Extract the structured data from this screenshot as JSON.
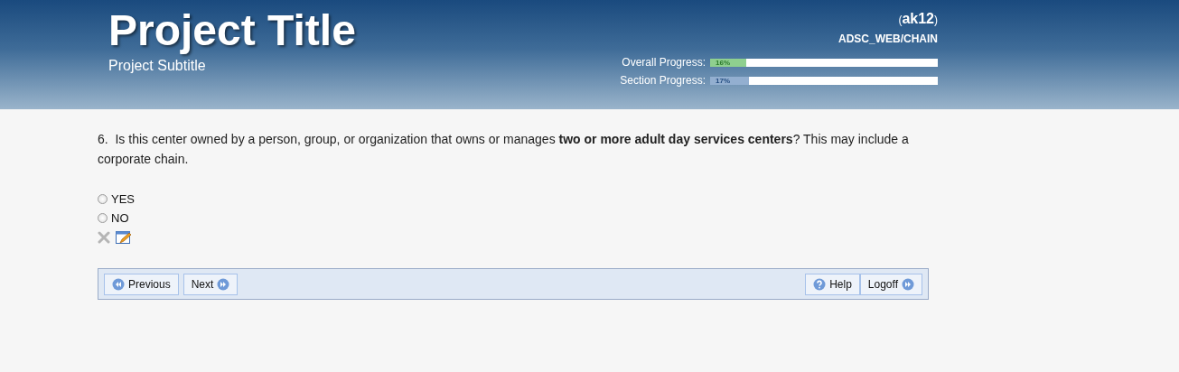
{
  "header": {
    "title": "Project Title",
    "subtitle": "Project Subtitle",
    "user": "(**ak12**)",
    "path": "ADSC_WEB/CHAIN",
    "progress": [
      {
        "label": "Overall Progress:",
        "level": 0.16,
        "reading": "16%",
        "kind": "overall"
      },
      {
        "label": "Section Progress:",
        "level": 0.17,
        "reading": "17%",
        "kind": "section"
      }
    ]
  },
  "question": {
    "number": "6.",
    "text": "Is this center owned by a person, group, or organization that owns or manages **two or more adult day services centers**? This may include a corporate chain.",
    "options": [
      {
        "label": "YES",
        "selected": false
      },
      {
        "label": "NO",
        "selected": false
      }
    ]
  },
  "nav": {
    "left": [
      {
        "label": "Previous",
        "kind": "back"
      },
      {
        "label": "Next",
        "kind": "forward"
      }
    ],
    "right": [
      {
        "label": "Help",
        "kind": "help"
      },
      {
        "label": "Logoff",
        "kind": "forward"
      }
    ]
  }
}
